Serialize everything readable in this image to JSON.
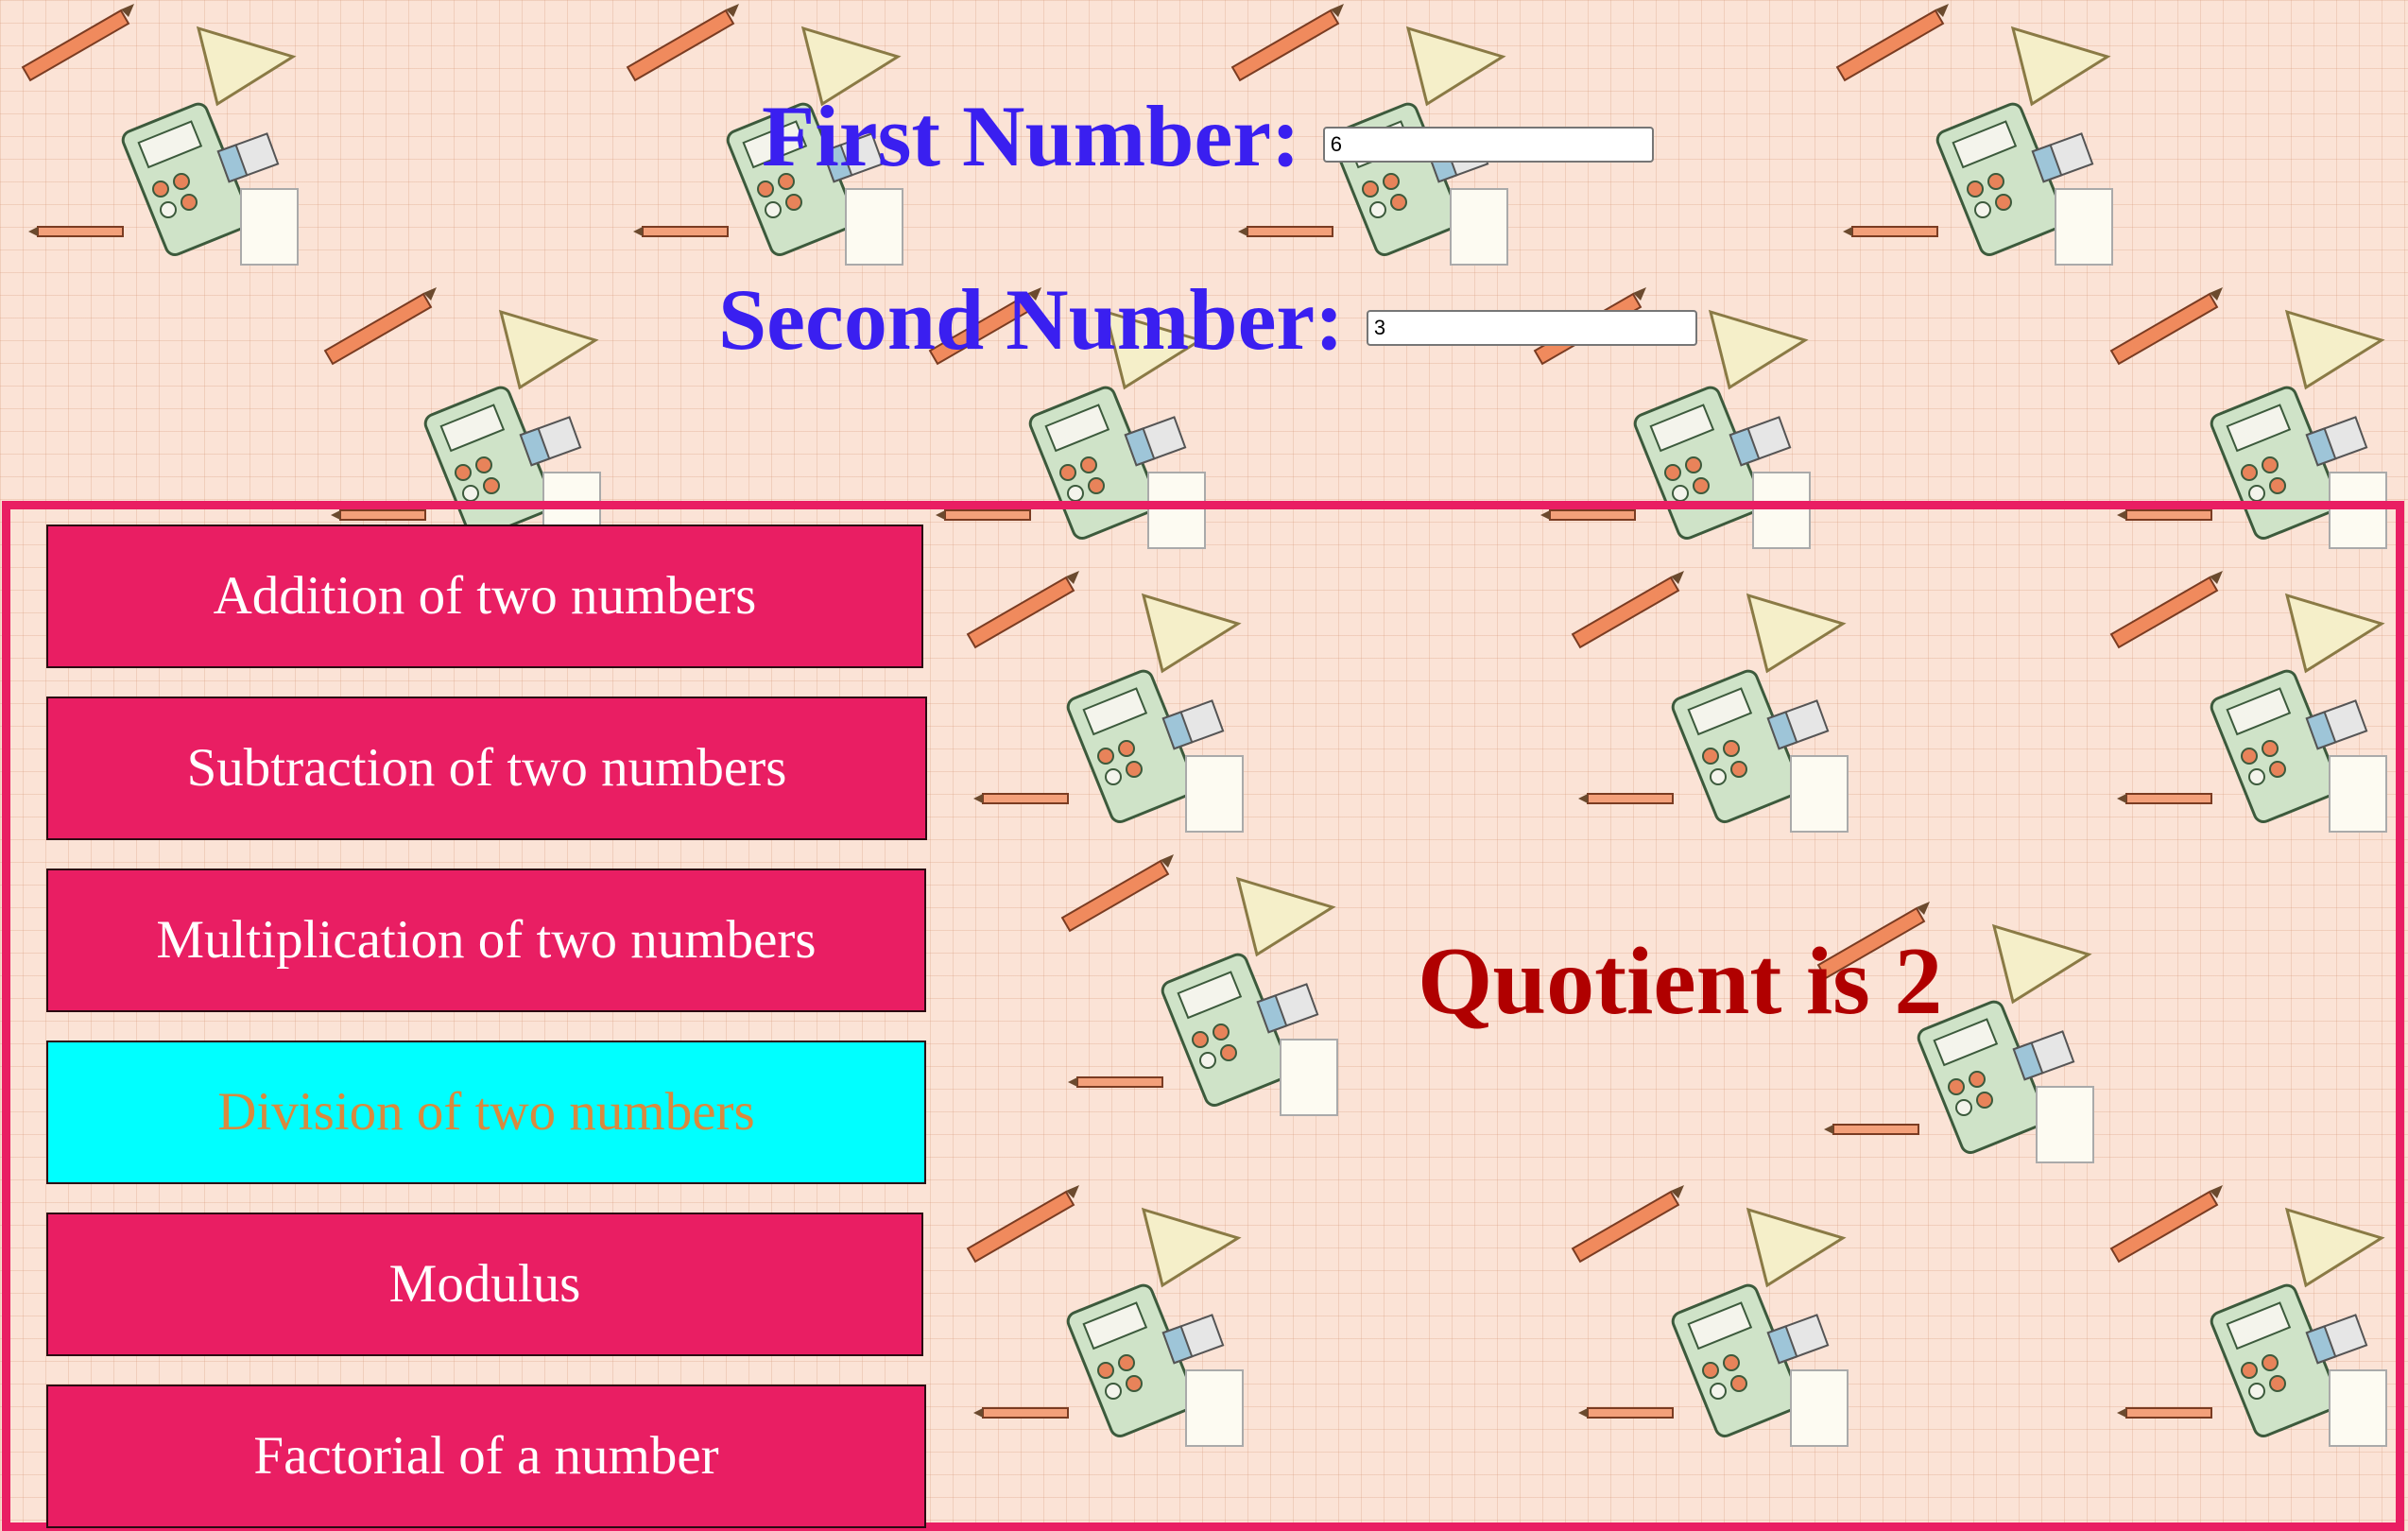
{
  "inputs": {
    "first": {
      "label": "First Number:",
      "value": "6"
    },
    "second": {
      "label": "Second Number:",
      "value": "3"
    }
  },
  "operations": [
    {
      "label": "Addition of two numbers",
      "active": false
    },
    {
      "label": "Subtraction of two numbers",
      "active": false
    },
    {
      "label": "Multiplication of two numbers",
      "active": false
    },
    {
      "label": "Division of two numbers",
      "active": true
    },
    {
      "label": "Modulus",
      "active": false
    },
    {
      "label": "Factorial of a number",
      "active": false
    }
  ],
  "result": {
    "text": "Quotient is 2"
  },
  "colors": {
    "label": "#3a1ff0",
    "button": "#e91e63",
    "button_active": "#00ffff",
    "button_active_text": "#d9893e",
    "result": "#b00000",
    "panel_border": "#e91e63",
    "background": "#fbe3d6"
  }
}
